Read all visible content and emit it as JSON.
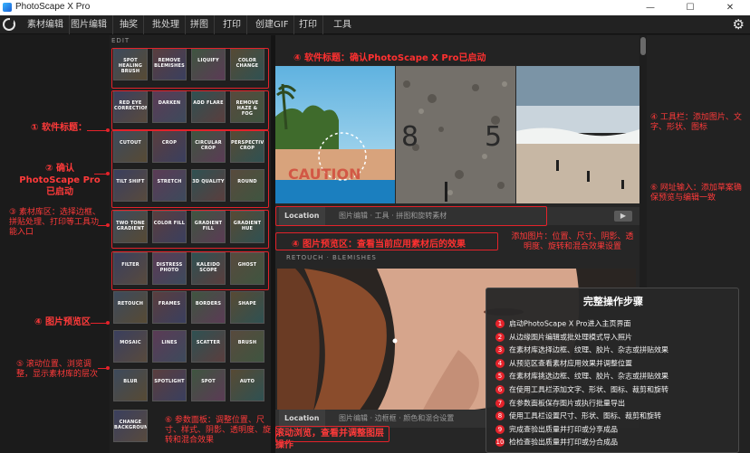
{
  "window": {
    "title": "PhotoScape X Pro",
    "minimize": "—",
    "maximize": "☐",
    "close": "✕"
  },
  "menu": [
    "素材编辑",
    "图片编辑",
    "抽奖",
    "批处理",
    "拼图",
    "打印",
    "创建GIF",
    "打印",
    "工具"
  ],
  "settings_icon": "gear-icon",
  "panel_label": "EDIT",
  "thumbnails": [
    [
      "SPOT HEALING BRUSH",
      "REMOVE BLEMISHES",
      "LIQUIFY",
      "COLOR CHANGE"
    ],
    [
      "RED EYE CORRECTION",
      "DARKEN",
      "ADD FLARE",
      "REMOVE HAZE & FOG"
    ],
    [
      "CUTOUT",
      "CROP",
      "CIRCULAR CROP",
      "PERSPECTIVE CROP"
    ],
    [
      "TILT SHIFT",
      "STRETCH",
      "3D QUALITY",
      "ROUND"
    ],
    [
      "TWO TONE GRADIENT",
      "COLOR FILL",
      "GRADIENT FILL",
      "GRADIENT HUE"
    ],
    [
      "FILTER",
      "DISTRESS PHOTO",
      "KALEIDO SCOPE",
      "GHOST"
    ],
    [
      "RETOUCH",
      "FRAMES",
      "BORDERS",
      "SHAPE"
    ],
    [
      "MOSAIC",
      "LINES",
      "SCATTER",
      "BRUSH"
    ],
    [
      "BLUR",
      "SPOTLIGHT",
      "SPOT",
      "AUTO"
    ],
    [
      "CHANGE BACKGROUND"
    ]
  ],
  "annotations": {
    "a4_top": "④ 软件标题：确认PhotoScape X Pro已启动",
    "a1": "① 软件标题：",
    "a2": "② 确认PhotoScape Pro已启动",
    "a3": "③ 素材库区：选择边框、拼贴处理、打印等工具功能入口",
    "a4_left": "④ 图片预览区",
    "a5": "⑤ 滚动位置、浏览调整，显示素材库的层次",
    "a6": "⑥ 参数面板：调整位置、尺寸、样式、阴影、透明度、旋转和混合效果",
    "a4_mid": "④ 图片预览区：查看当前应用素材后的效果",
    "a_tools": "④ 工具栏：添加图片、文字、形状、图标",
    "a_input": "⑥ 网址输入：添加草案确保预览与编辑一致",
    "a_params": "添加图片：位置、尺寸、阴影、透明度、旋转和混合效果设置",
    "a_bottom": "滚动浏览，查看并调整图层操作"
  },
  "preview": {
    "tab_active": "Location",
    "tab_rest": "图片编辑 · 工具 · 拼图和旋转素材",
    "section2_label": "RETOUCH · BLEMISHES",
    "tab2_active": "Location",
    "tab2_rest": "图片编辑 · 边框框 · 颜色和混合设置",
    "photo_text": "CAUTION"
  },
  "steps": {
    "title": "完整操作步骤",
    "items": [
      "启动PhotoScape X Pro进入主页界面",
      "从边缘图片编辑或批处理模式导入照片",
      "在素材库选择边框、纹理、胶片、杂志或拼贴效果",
      "从预览区查看素材应用效果并调整位置",
      "在素材库挑选边框、纹理、胶片、杂志或拼贴效果",
      "在使用工具栏添加文字、形状、图标、裁剪和旋转",
      "在参数面板保存图片或执行批量导出",
      "使用工具栏设置尺寸、形状、图标、裁剪和旋转",
      "完成查验出质量并打印或分享成品",
      "检检查验出质量并打印或分合成品"
    ]
  },
  "colors": {
    "accent": "#e4222a",
    "panel": "#1f1f1f",
    "window": "#1b1b1b"
  }
}
